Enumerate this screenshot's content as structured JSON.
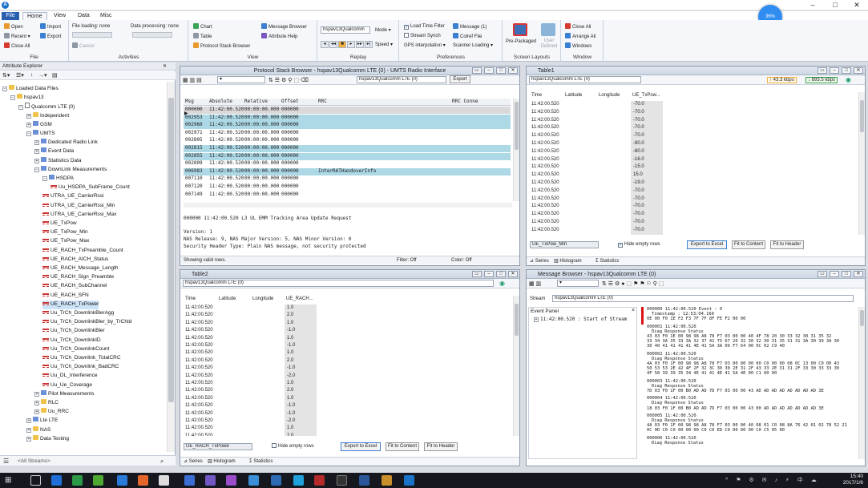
{
  "titlebar": {
    "minimize": "–",
    "maximize": "□",
    "close": "✕",
    "speed": "36%"
  },
  "tabs": {
    "file": "File",
    "home": "Home",
    "view": "View",
    "data": "Data",
    "misc": "Misc"
  },
  "ribbon": {
    "file": {
      "open": "Open",
      "recent": "Recent",
      "close_all": "Close All",
      "import": "Import",
      "export": "Export",
      "label": "File"
    },
    "activities": {
      "file_loading": "File loading: none",
      "data_processing": "Data processing: none",
      "cancel": "Cancel",
      "label": "Activities"
    },
    "view": {
      "chart": "Chart",
      "table": "Table",
      "protocol_stack_browser": "Protocol Stack Browser",
      "message_browser": "Message Browser",
      "attribute_help": "Attribute Help",
      "label": "View"
    },
    "replay": {
      "device": "hspav13Qualcomm",
      "mode": "Mode",
      "speed": "Speed",
      "label": "Replay"
    },
    "preferences": {
      "load_time_filter": "Load Time Filter",
      "stream_synch": "Stream Synch",
      "gps_interpolation": "GPS interpolation",
      "message": "Message (1)",
      "colref_file": "Colref File",
      "scanner_loading": "Scanner Loading",
      "label": "Preferences"
    },
    "screen_layouts": {
      "pre_packaged": "Pre-Packaged",
      "user_defined": "User Defined",
      "label": "Screen Layouts"
    },
    "window": {
      "close_all": "Close All",
      "arrange_all": "Arrange All",
      "windows": "Windows",
      "label": "Window"
    }
  },
  "explorer": {
    "title": "Attribute Explorer",
    "search_placeholder": "<All Streams>",
    "nodes": [
      {
        "label": "Loaded Data Files",
        "indent": 0,
        "exp": "−",
        "icon": "folder"
      },
      {
        "label": "hspav13",
        "indent": 1,
        "exp": "−",
        "icon": "folder"
      },
      {
        "label": "Qualcomm LTE (0)",
        "indent": 2,
        "exp": "−",
        "icon": "doc"
      },
      {
        "label": "Independent",
        "indent": 3,
        "exp": "+",
        "icon": "folder"
      },
      {
        "label": "GSM",
        "indent": 3,
        "exp": "+",
        "icon": "blue"
      },
      {
        "label": "UMTS",
        "indent": 3,
        "exp": "−",
        "icon": "blue"
      },
      {
        "label": "Dedicated Radio Link",
        "indent": 4,
        "exp": "+",
        "icon": "blue"
      },
      {
        "label": "Event Data",
        "indent": 4,
        "exp": "+",
        "icon": "blue"
      },
      {
        "label": "Statistics Data",
        "indent": 4,
        "exp": "+",
        "icon": "blue"
      },
      {
        "label": "DownLink Measurements",
        "indent": 4,
        "exp": "−",
        "icon": "blue"
      },
      {
        "label": "HSDPA",
        "indent": 5,
        "exp": "−",
        "icon": "blue"
      },
      {
        "label": "Uu_HSDPA_SubFrame_Count",
        "indent": 6,
        "exp": "",
        "icon": "sig"
      },
      {
        "label": "UTRA_UE_CarrierRssi",
        "indent": 5,
        "exp": "",
        "icon": "sig"
      },
      {
        "label": "UTRA_UE_CarrierRssi_Min",
        "indent": 5,
        "exp": "",
        "icon": "sig"
      },
      {
        "label": "UTRA_UE_CarrierRssi_Max",
        "indent": 5,
        "exp": "",
        "icon": "sig"
      },
      {
        "label": "UE_TxPow",
        "indent": 5,
        "exp": "",
        "icon": "sig"
      },
      {
        "label": "UE_TxPow_Min",
        "indent": 5,
        "exp": "",
        "icon": "sig"
      },
      {
        "label": "UE_TxPow_Max",
        "indent": 5,
        "exp": "",
        "icon": "sig"
      },
      {
        "label": "UE_RACH_TxPreamble_Count",
        "indent": 5,
        "exp": "",
        "icon": "sig"
      },
      {
        "label": "UE_RACH_AICH_Status",
        "indent": 5,
        "exp": "",
        "icon": "sig"
      },
      {
        "label": "UE_RACH_Message_Length",
        "indent": 5,
        "exp": "",
        "icon": "sig"
      },
      {
        "label": "UE_RACH_Sign_Preamble",
        "indent": 5,
        "exp": "",
        "icon": "sig"
      },
      {
        "label": "UE_RACH_SubChannel",
        "indent": 5,
        "exp": "",
        "icon": "sig"
      },
      {
        "label": "UE_RACH_SFN",
        "indent": 5,
        "exp": "",
        "icon": "sig"
      },
      {
        "label": "UE_RACH_TxPower",
        "indent": 5,
        "exp": "",
        "icon": "sig"
      },
      {
        "label": "Uu_TrCh_DownlinkBlerAgg",
        "indent": 5,
        "exp": "",
        "icon": "sig"
      },
      {
        "label": "Uu_TrCh_DownlinkBler_by_TrChId",
        "indent": 5,
        "exp": "",
        "icon": "sig"
      },
      {
        "label": "Uu_TrCh_DownlinkBler",
        "indent": 5,
        "exp": "",
        "icon": "sig"
      },
      {
        "label": "Uu_TrCh_DownlinkID",
        "indent": 5,
        "exp": "",
        "icon": "sig"
      },
      {
        "label": "Uu_TrCh_DownlinkCount",
        "indent": 5,
        "exp": "",
        "icon": "sig"
      },
      {
        "label": "Uu_TrCh_Downlink_TotalCRC",
        "indent": 5,
        "exp": "",
        "icon": "sig"
      },
      {
        "label": "Uu_TrCh_Downlink_BadCRC",
        "indent": 5,
        "exp": "",
        "icon": "sig"
      },
      {
        "label": "Uu_DL_Interference",
        "indent": 5,
        "exp": "",
        "icon": "sig"
      },
      {
        "label": "Uu_Ue_Coverage",
        "indent": 5,
        "exp": "",
        "icon": "sig"
      },
      {
        "label": "Pilot Measurements",
        "indent": 4,
        "exp": "+",
        "icon": "blue"
      },
      {
        "label": "RLC",
        "indent": 4,
        "exp": "+",
        "icon": "folder"
      },
      {
        "label": "Uu_RRC",
        "indent": 4,
        "exp": "+",
        "icon": "folder"
      },
      {
        "label": "Lte LTE",
        "indent": 3,
        "exp": "+",
        "icon": "blue"
      },
      {
        "label": "NAS",
        "indent": 3,
        "exp": "+",
        "icon": "folder"
      },
      {
        "label": "Data Testing",
        "indent": 3,
        "exp": "+",
        "icon": "folder"
      }
    ]
  },
  "protocol_browser": {
    "title": "Protocol Stack Browser - hspav13Qualcomm LTE (0) - UMTS Radio Interface",
    "device": "hspav13Qualcomm LTE (0)",
    "export": "Export",
    "columns": [
      "Msg",
      "Absolute",
      "Relative",
      "Offset",
      "RRC",
      "RRC Conne"
    ],
    "rows": [
      [
        "000000",
        "11:42:00.520",
        "00:00:00.000",
        "000000",
        "",
        ""
      ],
      [
        "002953",
        "11:42:00.520",
        "00:00:00.000",
        "000000",
        "",
        ""
      ],
      [
        "002960",
        "11:42:00.520",
        "00:00:00.000",
        "000000",
        "",
        ""
      ],
      [
        "002971",
        "11:42:00.520",
        "00:00:00.000",
        "000000",
        "",
        ""
      ],
      [
        "002805",
        "11:42:00.520",
        "00:00:00.000",
        "000000",
        "",
        ""
      ],
      [
        "002815",
        "11:42:00.520",
        "00:00:00.000",
        "000000",
        "",
        ""
      ],
      [
        "002855",
        "11:42:00.520",
        "00:00:00.000",
        "000000",
        "",
        ""
      ],
      [
        "002809",
        "11:42:00.520",
        "00:00:00.000",
        "000000",
        "",
        ""
      ],
      [
        "006983",
        "11:42:00.520",
        "00:00:00.000",
        "000000",
        "InterRATHandoverInfo",
        ""
      ],
      [
        "007110",
        "11:42:00.520",
        "00:00:00.000",
        "000000",
        "",
        ""
      ],
      [
        "007120",
        "11:42:00.520",
        "00:00:00.000",
        "000000",
        "",
        ""
      ],
      [
        "007149",
        "11:42:00.520",
        "00:00:00.000",
        "000000",
        "",
        ""
      ]
    ],
    "detail_header": "000000 11:42:00.520 L3 UL EMM Tracking Area Update Request",
    "detail_lines": [
      "Version: 1",
      "NAS Release: 9, NAS Major Version: 5, NAS Minor Version: 0",
      "Security Header Type: Plain NAS message, not security protected"
    ],
    "status_left": "Showing valid rows.",
    "status_filter": "Filter: Off",
    "status_color": "Color: Off"
  },
  "table1": {
    "title": "Table1",
    "device": "hspav13Qualcomm LTE (0)",
    "rate1": "43.3 kbps",
    "rate2": "893.5 kbps",
    "columns": [
      "Time",
      "Latitude",
      "Longitude",
      "UE_TxPow..."
    ],
    "rows": [
      [
        "11:42:00.520",
        "-70.0"
      ],
      [
        "11:42:00.520",
        "-70.0"
      ],
      [
        "11:42:00.520",
        "-70.0"
      ],
      [
        "11:42:00.520",
        "-70.0"
      ],
      [
        "11:42:00.520",
        "-70.0"
      ],
      [
        "11:42:00.520",
        "-90.0"
      ],
      [
        "11:42:00.520",
        "-80.0"
      ],
      [
        "11:42:00.520",
        "-16.0"
      ],
      [
        "11:42:00.520",
        "-15.0"
      ],
      [
        "11:42:00.520",
        "15.0"
      ],
      [
        "11:42:00.520",
        "-19.0"
      ],
      [
        "11:42:00.520",
        "-70.0"
      ],
      [
        "11:42:00.520",
        "-70.0"
      ],
      [
        "11:42:00.520",
        "-70.0"
      ],
      [
        "11:42:00.520",
        "-70.0"
      ],
      [
        "11:42:00.520",
        "-70.0"
      ],
      [
        "11:42:00.520",
        "-70.0"
      ]
    ],
    "attr_select": "UE_TxPow_Min",
    "hide_empty": "Hide empty rows",
    "export_excel": "Export to Excel",
    "fit_content": "Fit to Content",
    "fit_header": "Fit to Header",
    "tab_series": "Series",
    "tab_histogram": "Histogram",
    "tab_statistics": "Statistics"
  },
  "table2": {
    "title": "Table2",
    "device": "hspav13Qualcomm LTE (0)",
    "columns": [
      "Time",
      "Latitude",
      "Longitude",
      "UE_RACH..."
    ],
    "rows": [
      [
        "11:42:00.520",
        "1.0"
      ],
      [
        "11:42:00.520",
        "2.0"
      ],
      [
        "11:42:00.520",
        "1.0"
      ],
      [
        "11:42:00.520",
        "-1.0"
      ],
      [
        "11:42:00.520",
        "1.0"
      ],
      [
        "11:42:00.520",
        "-1.0"
      ],
      [
        "11:42:00.520",
        "1.0"
      ],
      [
        "11:42:00.520",
        "2.0"
      ],
      [
        "11:42:00.520",
        "-1.0"
      ],
      [
        "11:42:00.520",
        "-2.0"
      ],
      [
        "11:42:00.520",
        "1.0"
      ],
      [
        "11:42:00.520",
        "2.0"
      ],
      [
        "11:42:00.520",
        "1.0"
      ],
      [
        "11:42:00.520",
        "-1.0"
      ],
      [
        "11:42:00.520",
        "-1.0"
      ],
      [
        "11:42:00.520",
        "-2.0"
      ],
      [
        "11:42:00.520",
        "1.0"
      ],
      [
        "11:42:00.520",
        "2.0"
      ]
    ],
    "attr_select": "UE_RACH_TxPowe",
    "hide_empty": "Hide empty rows",
    "export_excel": "Export to Excel",
    "fit_content": "Fit to Content",
    "fit_header": "Fit to Header",
    "tab_series": "Series",
    "tab_histogram": "Histogram",
    "tab_statistics": "Statistics"
  },
  "message_browser": {
    "title": "Message Browser - hspav13Qualcomm LTE (0)",
    "stream_label": "Stream",
    "stream_value": "hspav13Qualcomm LTE (0)",
    "event_panel": "Event Panel",
    "event_close": "×",
    "event_row": "11:42:00.520 : Start of Stream",
    "messages": [
      {
        "head": "000000 11:42:00.520 Event : 0",
        "lines": [
          "Timestamp  : 12:53:04.160",
          "0E 00 F0 1E F2 F3 7F 7F 8F FE F2 00 00"
        ]
      },
      {
        "head": "000001 11:42:00.520",
        "lines": [
          "Diag Response Status",
          "43 03 F0 1E 00 98 98 A8 78 F7 03 00 00 40 4F 78 20 30 33 32 30 31 35 32",
          "33 34 3A 35 33 3A 32 37 41 75 67 20 32 30 32 30 31 35 31 31 3A 30 39 3A 30",
          "30 40 41 41 41 41 4E 41 5A 3A 09 F7 64 00 0C 02 C9 40"
        ]
      },
      {
        "head": "000002 11:42:00.520",
        "lines": [
          "Diag Response Status",
          "4A 03 F0 1F 00 98 98 A8 78 F7 03 00 00 00 00 C0 00 00 08 0C 13 00 C0 00 43",
          "50 53 53 2E 42 4F 2F 32 3C 30 30 2E 31 2F 43 33 2E 31 31 2F 33 30 33 33 30",
          "4F 58 39 39 35 34 4E 41 41 4E 41 5A 4E 00 C1 00 00"
        ]
      },
      {
        "head": "000003 11:42:00.520",
        "lines": [
          "Diag Response Status",
          "7D 03 F0 1F 00 B0 AD AD 7D F7 03 00 00 43 AD AD AD AD AD AD AD AD 3E"
        ]
      },
      {
        "head": "000004 11:42:00.520",
        "lines": [
          "Diag Response Status",
          "18 03 F0 1F 00 B0 AD AD 7D F7 03 00 00 43 00 AD AD AD AD AD AD AD 3E"
        ]
      },
      {
        "head": "000005 11:42:00.520",
        "lines": [
          "Diag Response Status",
          "4A 03 F0 1F 00 98 98 A8 78 F7 03 00 00 40 08 01 C0 08 8A 76 42 01 02 78 52 21",
          "0C 0D C0 C0 00 00 00 C0 C0 ED C0 00 00 00 C0 C5 05 00"
        ]
      },
      {
        "head": "000006 11:42:00.520",
        "lines": [
          "Diag Response Status"
        ]
      }
    ]
  },
  "taskbar": {
    "time": "15:40",
    "date": "2017/1/6"
  }
}
